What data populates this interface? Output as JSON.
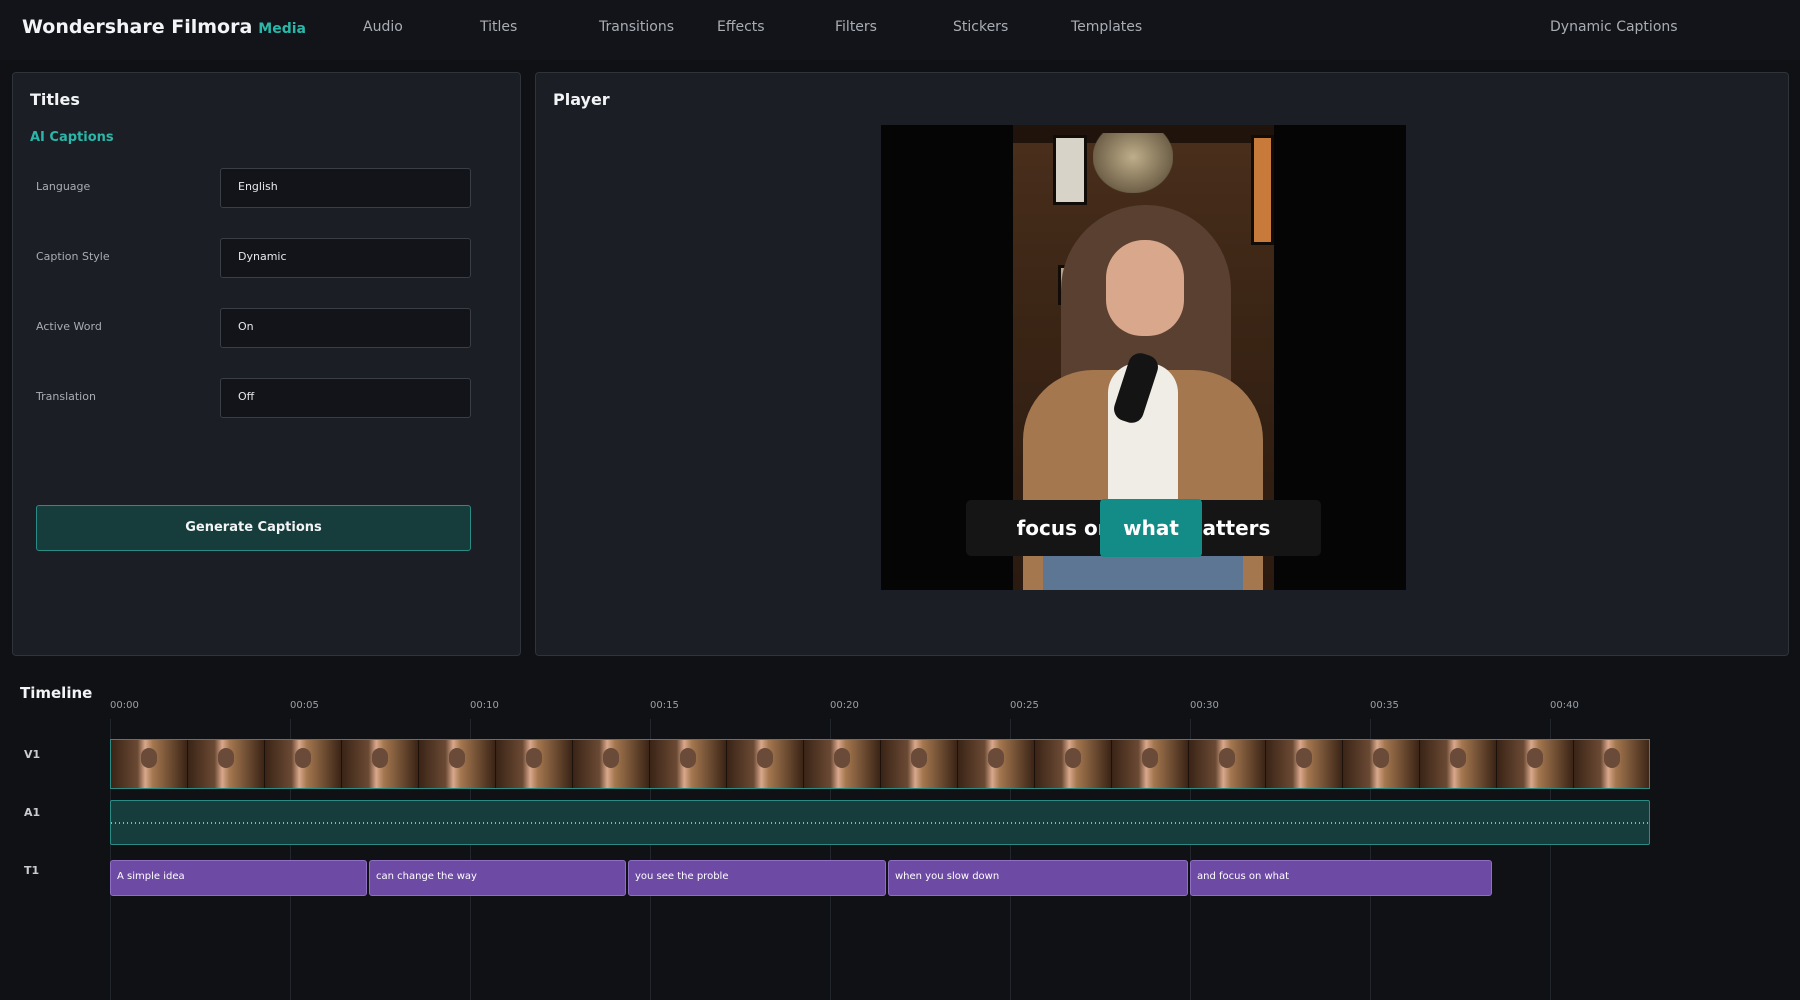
{
  "app": {
    "name": "Wondershare Filmora",
    "section": "Media"
  },
  "nav": {
    "items": [
      "Audio",
      "Titles",
      "Transitions",
      "Effects",
      "Filters",
      "Stickers",
      "Templates"
    ],
    "right_label": "Dynamic Captions"
  },
  "titles_panel": {
    "title": "Titles",
    "section_label": "AI Captions",
    "fields": [
      {
        "label": "Language",
        "value": "English"
      },
      {
        "label": "Caption Style",
        "value": "Dynamic"
      },
      {
        "label": "Active Word",
        "value": "On"
      },
      {
        "label": "Translation",
        "value": "Off"
      }
    ],
    "generate_button": "Generate Captions"
  },
  "player": {
    "title": "Player",
    "caption_line": "focus on what matters",
    "active_word": "what"
  },
  "timeline": {
    "title": "Timeline",
    "ticks": [
      "00:00",
      "00:05",
      "00:10",
      "00:15",
      "00:20",
      "00:25",
      "00:30",
      "00:35",
      "00:40"
    ],
    "tracks": [
      "V1",
      "A1",
      "T1"
    ],
    "caption_clips": [
      "A simple idea",
      "can change the way",
      "you see the proble",
      "when you slow down",
      "and focus on what"
    ]
  },
  "colors": {
    "accent": "#2ab7a9",
    "caption_clip": "#6d4aa3",
    "audio_track": "#163c3b"
  },
  "icons": []
}
